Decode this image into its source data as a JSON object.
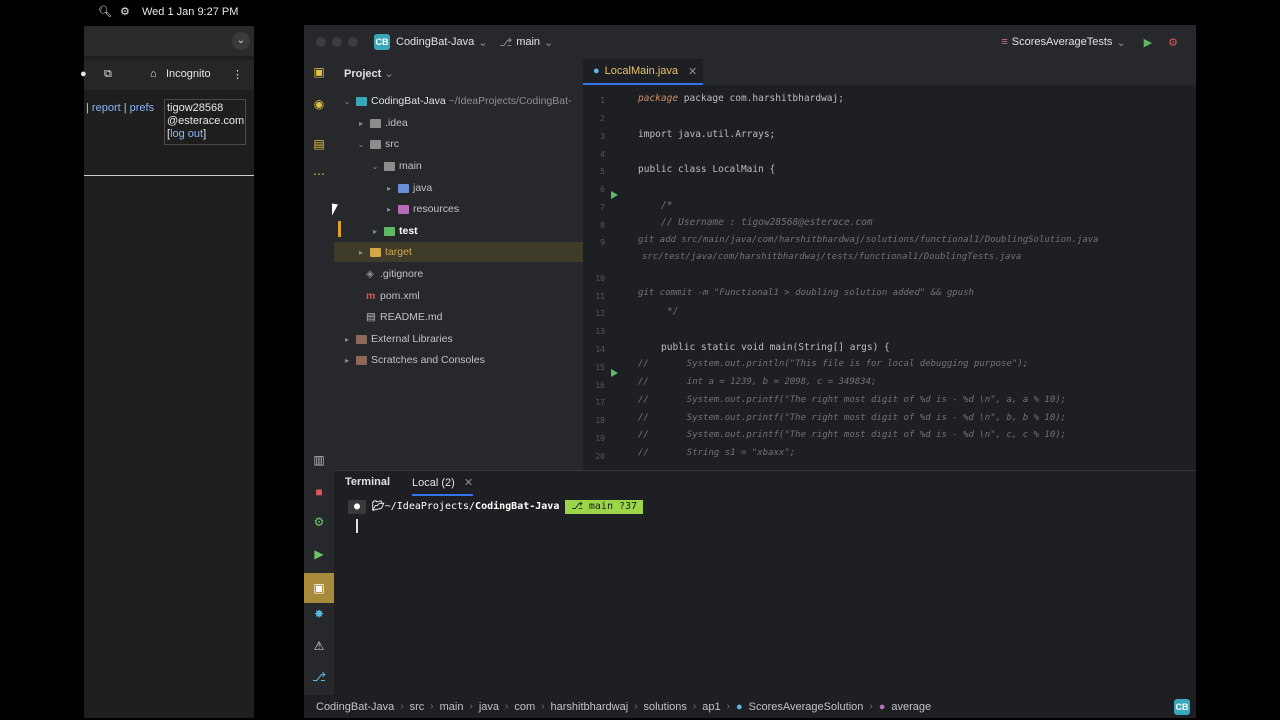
{
  "menubar": {
    "datetime": "Wed 1 Jan  9:27 PM"
  },
  "browser": {
    "mode": "Incognito",
    "links": [
      "report",
      "prefs"
    ],
    "user": {
      "line1": "tigow28568",
      "line2": "@esterace.com",
      "logout": "log out"
    }
  },
  "ide": {
    "project_badge": "CB",
    "project_name": "CodingBat-Java",
    "branch": "main",
    "run_config": "ScoresAverageTests",
    "project_panel_title": "Project",
    "tree": [
      {
        "label": "CodingBat-Java",
        "suffix": "~/IdeaProjects/CodingBat-",
        "indent": 0
      },
      {
        "label": ".idea",
        "indent": 1
      },
      {
        "label": "src",
        "indent": 1
      },
      {
        "label": "main",
        "indent": 2
      },
      {
        "label": "java",
        "indent": 3
      },
      {
        "label": "resources",
        "indent": 3
      },
      {
        "label": "test",
        "indent": 2
      },
      {
        "label": "target",
        "indent": 1
      },
      {
        "label": ".gitignore",
        "indent": 1
      },
      {
        "label": "pom.xml",
        "indent": 1
      },
      {
        "label": "README.md",
        "indent": 1
      },
      {
        "label": "External Libraries",
        "indent": 0
      },
      {
        "label": "Scratches and Consoles",
        "indent": 0
      }
    ],
    "editor_tab": "LocalMain.java",
    "code_lines": [
      "package com.harshitbhardwaj;",
      "import java.util.Arrays;",
      "public class LocalMain {",
      "/*",
      "// Username : tigow28568@esterace.com",
      "git add src/main/java/com/harshitbhardwaj/solutions/functional1/DoublingSolution.java",
      "src/test/java/com/harshitbhardwaj/tests/functional1/DoublingTests.java",
      "git commit -m \"Functional1 > doubling solution added\" && gpush",
      "*/",
      "public static void main(String[] args) {",
      "System.out.println(\"This file is for local debugging purpose\");",
      "int a = 1239, b = 2098, c = 349834;",
      "System.out.printf(\"The right most digit of %d is - %d \\n\", a, a % 10);",
      "System.out.printf(\"The right most digit of %d is - %d \\n\", b, b % 10);",
      "System.out.printf(\"The right most digit of %d is - %d \\n\", c, c % 10);",
      "String s1 = \"xbaxx\";"
    ],
    "terminal_title": "Terminal",
    "terminal_tab": "Local (2)",
    "prompt": {
      "path_prefix": "~/IdeaProjects/",
      "path_bold": "CodingBat-Java",
      "git": "main ?37"
    },
    "breadcrumb": [
      "CodingBat-Java",
      "src",
      "main",
      "java",
      "com",
      "harshitbhardwaj",
      "solutions",
      "ap1",
      "ScoresAverageSolution",
      "average"
    ]
  }
}
